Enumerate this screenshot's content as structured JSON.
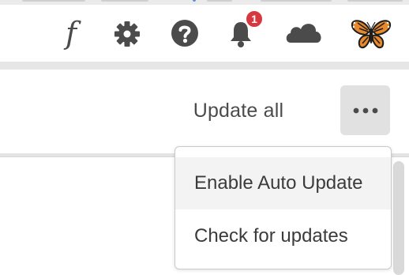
{
  "header": {
    "icons": [
      "font-icon",
      "gear-icon",
      "help-icon",
      "bell-icon",
      "cloud-icon",
      "butterfly-avatar-icon"
    ],
    "font_glyph": "f",
    "notification_count": "1"
  },
  "toolbar": {
    "update_all_label": "Update all",
    "more_icon": "ellipsis-icon"
  },
  "menu": {
    "items": [
      {
        "label": "Enable Auto Update",
        "highlighted": true
      },
      {
        "label": "Check for updates",
        "highlighted": false
      }
    ]
  },
  "colors": {
    "badge": "#d7373f",
    "icon": "#4b4b4b",
    "butterfly_orange": "#e8892b",
    "button_bg": "#e1e1e1"
  }
}
